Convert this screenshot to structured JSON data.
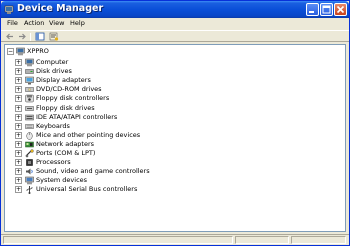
{
  "window": {
    "title": "Device Manager"
  },
  "menu": {
    "items": [
      "File",
      "Action",
      "View",
      "Help"
    ]
  },
  "tree": {
    "root": "XPPRO",
    "categories": [
      {
        "label": "Computer",
        "icon": "computer-icon"
      },
      {
        "label": "Disk drives",
        "icon": "disk-drive-icon"
      },
      {
        "label": "Display adapters",
        "icon": "display-adapter-icon"
      },
      {
        "label": "DVD/CD-ROM drives",
        "icon": "cdrom-icon"
      },
      {
        "label": "Floppy disk controllers",
        "icon": "floppy-controller-icon"
      },
      {
        "label": "Floppy disk drives",
        "icon": "floppy-drive-icon"
      },
      {
        "label": "IDE ATA/ATAPI controllers",
        "icon": "ide-controller-icon"
      },
      {
        "label": "Keyboards",
        "icon": "keyboard-icon"
      },
      {
        "label": "Mice and other pointing devices",
        "icon": "mouse-icon"
      },
      {
        "label": "Network adapters",
        "icon": "network-adapter-icon"
      },
      {
        "label": "Ports (COM & LPT)",
        "icon": "port-icon"
      },
      {
        "label": "Processors",
        "icon": "processor-icon"
      },
      {
        "label": "Sound, video and game controllers",
        "icon": "sound-icon"
      },
      {
        "label": "System devices",
        "icon": "system-device-icon"
      },
      {
        "label": "Universal Serial Bus controllers",
        "icon": "usb-icon"
      }
    ]
  },
  "colors": {
    "titlebar": "#0a4fd8",
    "close": "#c9411c",
    "tree_border": "#7f9db9"
  }
}
